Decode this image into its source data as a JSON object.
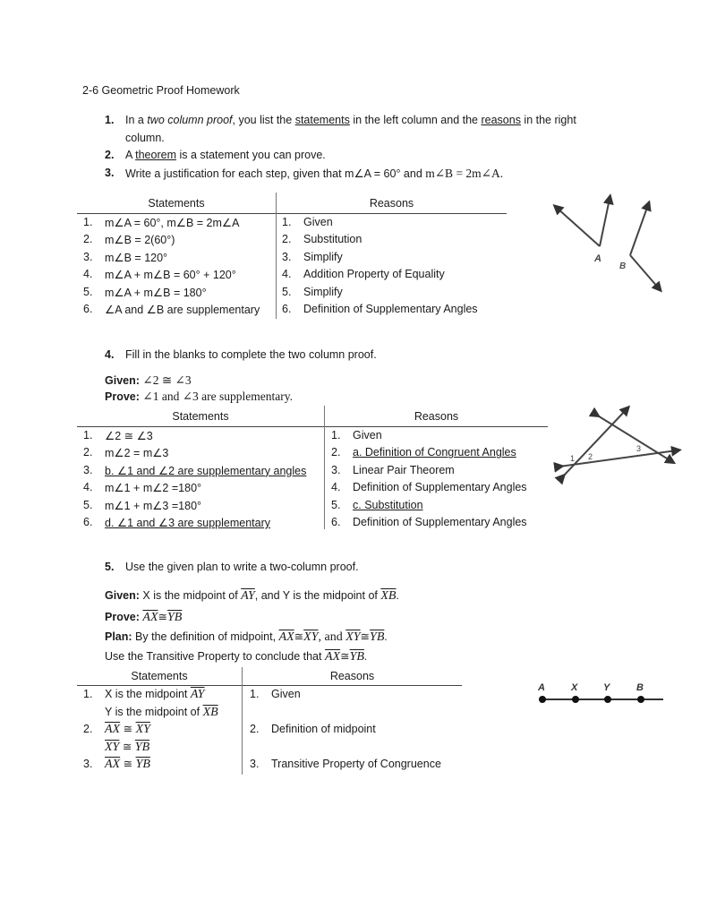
{
  "title": "2-6 Geometric Proof Homework",
  "q1": {
    "num": "1.",
    "pre": "In a ",
    "italic": "two column proof",
    "mid1": ", you list the ",
    "u1": "statements",
    "mid2": " in the left column and the ",
    "u2": "reasons",
    "post": " in the right",
    "line2": "column."
  },
  "q2": {
    "num": "2.",
    "pre": "A ",
    "u": "theorem",
    "post": " is a statement you can prove."
  },
  "q3": {
    "num": "3.",
    "text": "Write a justification for each step, given that m∠A = 60° and ",
    "math": "m∠B = 2m∠A."
  },
  "table1": {
    "headers": [
      "Statements",
      "Reasons"
    ],
    "rows": [
      {
        "n": "1.",
        "statement": "m∠A = 60°, m∠B = 2m∠A",
        "rn": "1.",
        "reason": "Given"
      },
      {
        "n": "2.",
        "statement": "m∠B = 2(60°)",
        "rn": "2.",
        "reason": "Substitution"
      },
      {
        "n": "3.",
        "statement": "m∠B = 120°",
        "rn": "3.",
        "reason": "Simplify"
      },
      {
        "n": "4.",
        "statement": "m∠A + m∠B = 60° + 120°",
        "rn": "4.",
        "reason": "Addition Property of Equality"
      },
      {
        "n": "5.",
        "statement": "m∠A + m∠B = 180°",
        "rn": "5.",
        "reason": "Simplify"
      },
      {
        "n": "6.",
        "statement": "∠A  and ∠B are supplementary",
        "rn": "6.",
        "reason": "Definition of Supplementary Angles"
      }
    ]
  },
  "figure1": {
    "labels": [
      "A",
      "B"
    ]
  },
  "q4": {
    "num": "4.",
    "text": "Fill in the blanks to complete the two column proof.",
    "given_label": "Given:",
    "given": "∠2 ≅ ∠3",
    "prove_label": "Prove:",
    "prove": "∠1 and ∠3 are supplementary."
  },
  "table2": {
    "headers": [
      "Statements",
      "Reasons"
    ],
    "rows": [
      {
        "n": "1.",
        "statement": "∠2 ≅ ∠3",
        "s_underline": false,
        "rn": "1.",
        "reason": "Given",
        "r_underline": false
      },
      {
        "n": "2.",
        "statement": "m∠2 = m∠3",
        "s_underline": false,
        "rn": "2.",
        "reason": "a. Definition of Congruent Angles",
        "r_underline": true
      },
      {
        "n": "3.",
        "statement": "b. ∠1 and ∠2 are supplementary angles",
        "s_underline": true,
        "rn": "3.",
        "reason": "Linear Pair Theorem",
        "r_underline": false
      },
      {
        "n": "4.",
        "statement": "m∠1 + m∠2 =180°",
        "s_underline": false,
        "rn": "4.",
        "reason": "Definition of Supplementary Angles",
        "r_underline": false
      },
      {
        "n": "5.",
        "statement": "m∠1 + m∠3 =180°",
        "s_underline": false,
        "rn": "5.",
        "reason": "c. Substitution",
        "r_underline": true
      },
      {
        "n": "6.",
        "statement": "d. ∠1  and ∠3 are supplementary",
        "s_underline": true,
        "rn": "6.",
        "reason": "Definition of Supplementary Angles",
        "r_underline": false
      }
    ]
  },
  "figure2": {
    "labels": [
      "1",
      "2",
      "3"
    ]
  },
  "q5": {
    "num": "5.",
    "text": "Use the given plan to write a two-column proof.",
    "given_label": "Given:",
    "given_pre": " X is the midpoint of ",
    "given_seg1": "AY",
    "given_mid": ", and Y is the midpoint of ",
    "given_seg2": "XB",
    "given_post": ".",
    "prove_label": "Prove:",
    "prove_seg1": "AX",
    "prove_cong": "≅",
    "prove_seg2": "YB",
    "plan_label": "Plan:",
    "plan_pre": " By the definition of midpoint, ",
    "plan_seg1": "AX",
    "plan_seg2": "XY",
    "plan_and": ", and ",
    "plan_seg3": "XY",
    "plan_seg4": "YB",
    "plan_post": ".",
    "line4_pre": "Use the Transitive Property to conclude that ",
    "line4_seg1": "AX",
    "line4_seg2": "YB",
    "line4_post": "."
  },
  "table3": {
    "headers": [
      "Statements",
      "Reasons"
    ],
    "rows": [
      {
        "n": "1.",
        "line1_pre": "X is the midpoint ",
        "line1_seg": "AY",
        "line2_pre": "Y is the midpoint of ",
        "line2_seg": "XB",
        "rn": "1.",
        "reason": "Given"
      },
      {
        "n": "2.",
        "seg_a": "AX",
        "seg_b": "XY",
        "seg_c": "XY",
        "seg_d": "YB",
        "rn": "2.",
        "reason": "Definition of midpoint"
      },
      {
        "n": "3.",
        "seg_a": "AX",
        "seg_b": "YB",
        "rn": "3.",
        "reason": "Transitive Property of Congruence"
      }
    ],
    "cong": "≅"
  },
  "figure3": {
    "labels": [
      "A",
      "X",
      "Y",
      "B"
    ]
  }
}
